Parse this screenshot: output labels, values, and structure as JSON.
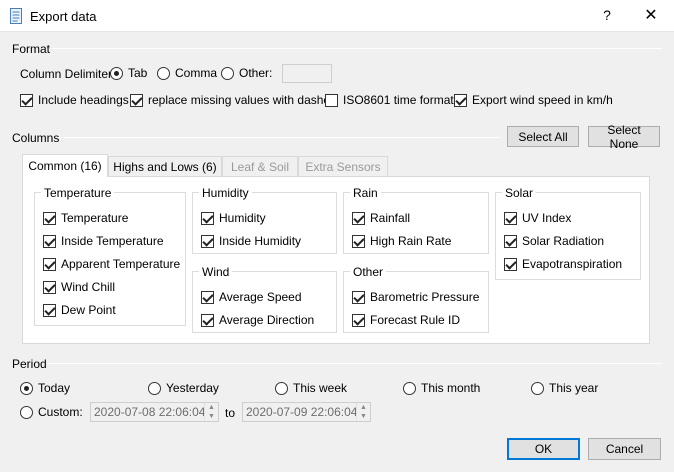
{
  "window": {
    "title": "Export data",
    "help_label": "?",
    "close_label": "✕"
  },
  "format": {
    "label": "Format",
    "delimiter_label": "Column Delimiter:",
    "delimiters": [
      {
        "label": "Tab",
        "checked": true
      },
      {
        "label": "Comma",
        "checked": false
      },
      {
        "label": "Other:",
        "checked": false
      }
    ],
    "other_value": "",
    "options": [
      {
        "label": "Include headings",
        "checked": true
      },
      {
        "label": "replace missing values with dashes",
        "checked": true
      },
      {
        "label": "ISO8601 time format",
        "checked": false
      },
      {
        "label": "Export wind speed in km/h",
        "checked": true
      }
    ]
  },
  "columns": {
    "label": "Columns",
    "select_all_label": "Select All",
    "select_none_label": "Select None",
    "tabs": [
      {
        "label": "Common (16)",
        "active": true,
        "enabled": true
      },
      {
        "label": "Highs and Lows (6)",
        "active": false,
        "enabled": true
      },
      {
        "label": "Leaf & Soil",
        "active": false,
        "enabled": false
      },
      {
        "label": "Extra Sensors",
        "active": false,
        "enabled": false
      }
    ],
    "groups": {
      "temperature": {
        "title": "Temperature",
        "items": [
          "Temperature",
          "Inside Temperature",
          "Apparent Temperature",
          "Wind Chill",
          "Dew Point"
        ]
      },
      "humidity": {
        "title": "Humidity",
        "items": [
          "Humidity",
          "Inside Humidity"
        ]
      },
      "wind": {
        "title": "Wind",
        "items": [
          "Average Speed",
          "Average Direction"
        ]
      },
      "rain": {
        "title": "Rain",
        "items": [
          "Rainfall",
          "High Rain Rate"
        ]
      },
      "other": {
        "title": "Other",
        "items": [
          "Barometric Pressure",
          "Forecast Rule ID"
        ]
      },
      "solar": {
        "title": "Solar",
        "items": [
          "UV Index",
          "Solar Radiation",
          "Evapotranspiration"
        ]
      }
    }
  },
  "period": {
    "label": "Period",
    "options": [
      {
        "label": "Today",
        "checked": true
      },
      {
        "label": "Yesterday",
        "checked": false
      },
      {
        "label": "This week",
        "checked": false
      },
      {
        "label": "This month",
        "checked": false
      },
      {
        "label": "This year",
        "checked": false
      }
    ],
    "custom_label": "Custom:",
    "custom_checked": false,
    "from": "2020-07-08 22:06:04",
    "to_label": "to",
    "to": "2020-07-09 22:06:04"
  },
  "buttons": {
    "ok": "OK",
    "cancel": "Cancel"
  },
  "icons": {
    "window": "document-icon",
    "spin_up": "spin-up-icon",
    "spin_down": "spin-down-icon"
  }
}
